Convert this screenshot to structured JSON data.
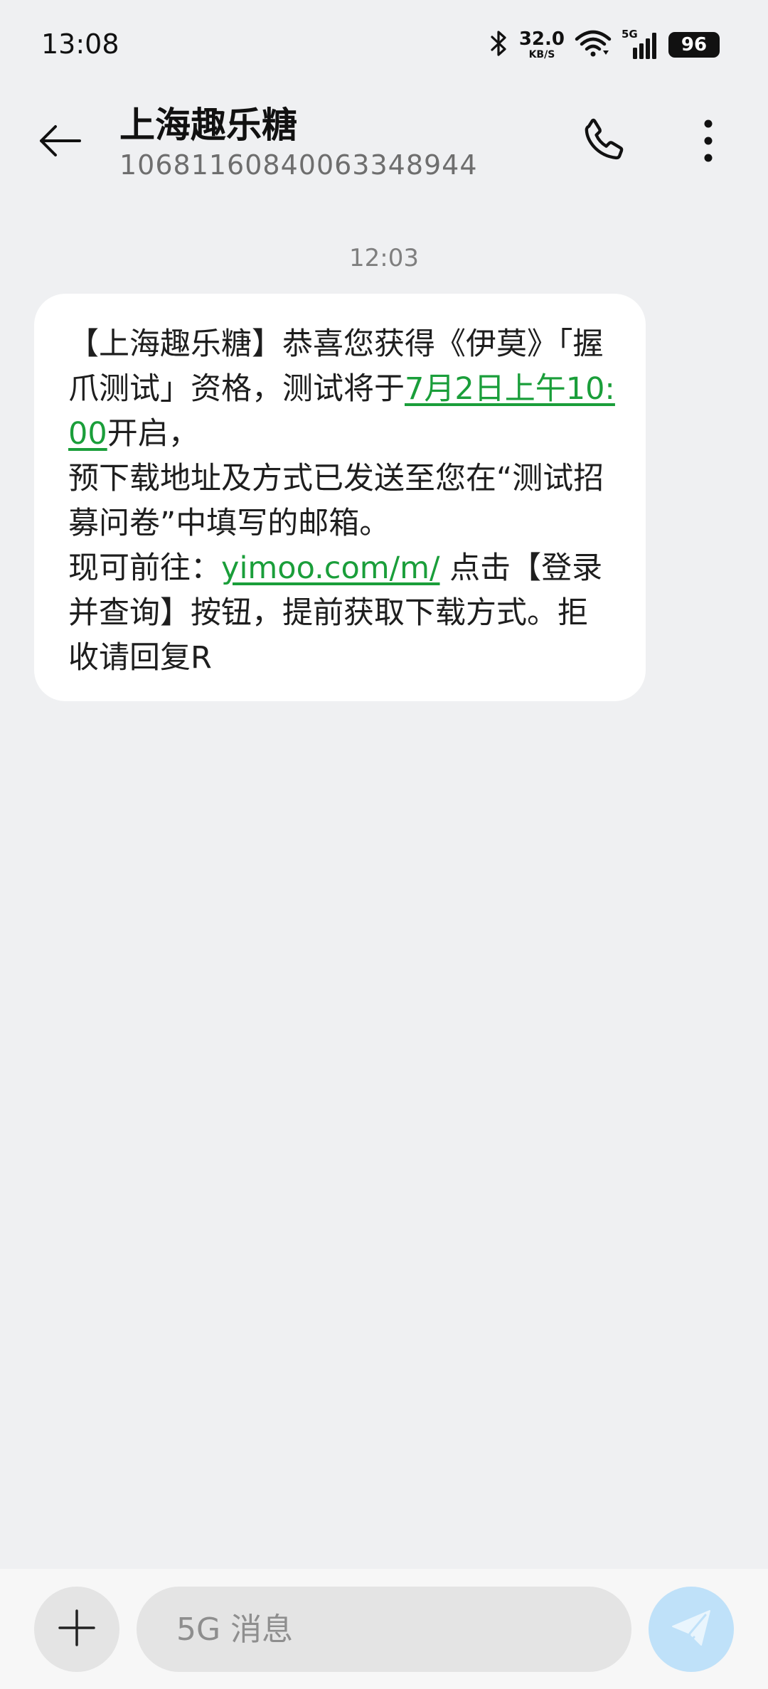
{
  "status_bar": {
    "time": "13:08",
    "net_speed_value": "32.0",
    "net_speed_unit": "KB/S",
    "network_label": "5G",
    "battery_level": "96"
  },
  "header": {
    "contact_name": "上海趣乐糖",
    "contact_number": "1068116084006334894​4"
  },
  "conversation": {
    "timestamp": "12:03",
    "message": {
      "line_1": "【上海趣乐糖】恭喜您获得《伊莫》「握爪测试」资格，测试将于",
      "date_link": "7月2日上午10:00",
      "line_2": "开启，",
      "line_3": "预下载地址及方式已发送至您在“测试招募问卷”中填写的邮箱。",
      "line_4_prefix": "现可前往：",
      "url_link": "yimoo.com/m/",
      "line_4_suffix": " 点击【登录并查询】按钮，提前获取下载方式。拒收请回复R"
    }
  },
  "input_bar": {
    "placeholder": "5G 消息",
    "value": ""
  },
  "icons": {
    "back": "back-arrow-icon",
    "call": "phone-icon",
    "more": "more-vertical-icon",
    "bluetooth": "bluetooth-icon",
    "wifi": "wifi-icon",
    "signal": "cellular-signal-icon",
    "add": "plus-icon",
    "send": "send-icon"
  },
  "colors": {
    "background": "#eff0f2",
    "bubble": "#ffffff",
    "link": "#1a9e3a",
    "send_button": "#bfe1f9"
  }
}
